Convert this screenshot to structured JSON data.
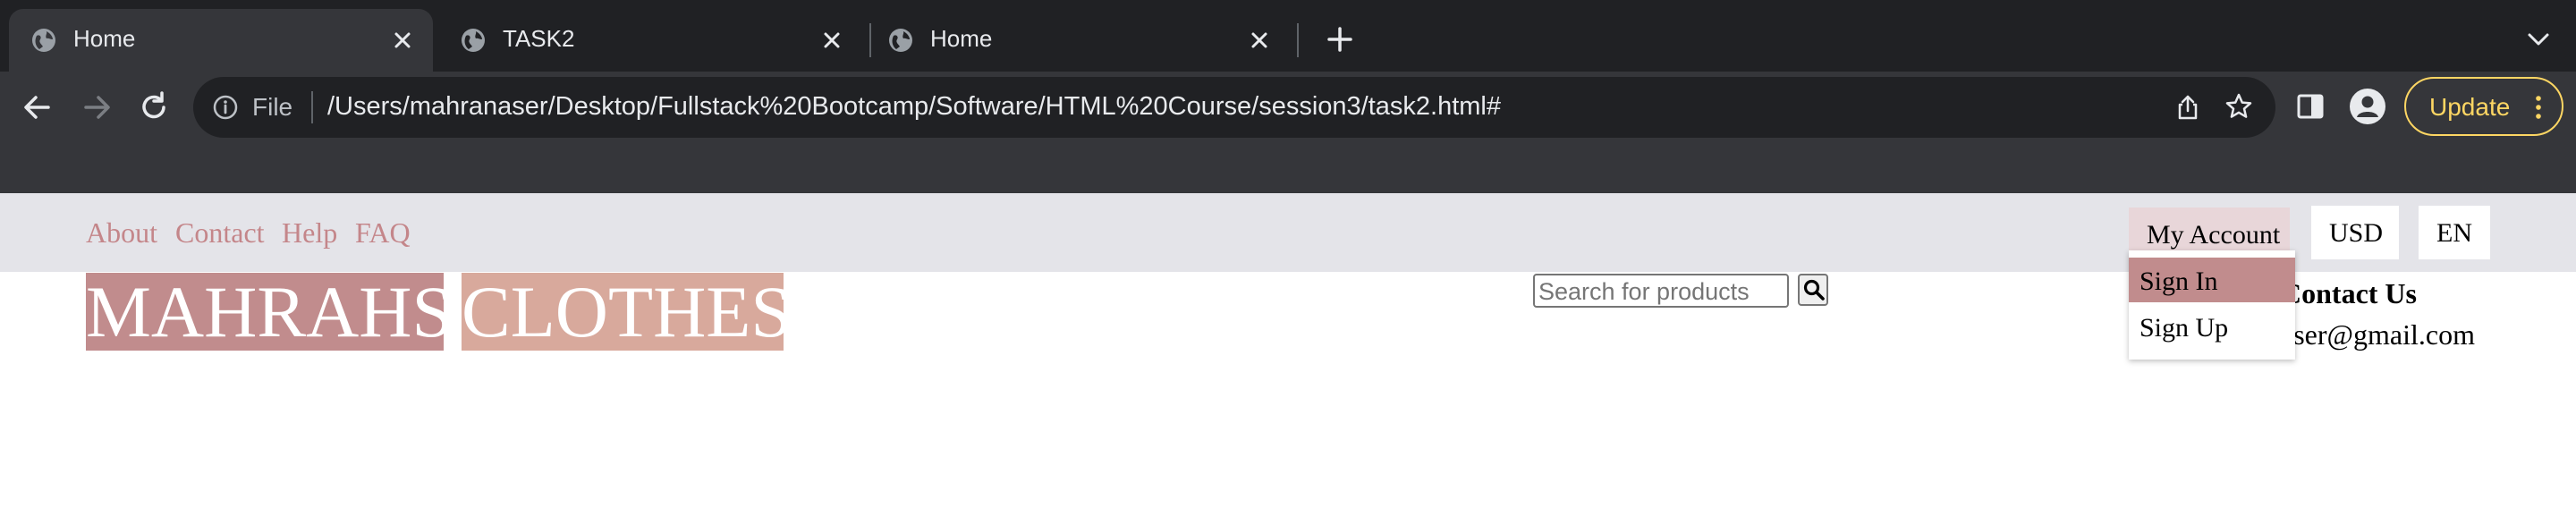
{
  "browser": {
    "tabs": [
      {
        "title": "Home",
        "active": true
      },
      {
        "title": "TASK2",
        "active": false
      },
      {
        "title": "Home",
        "active": false
      }
    ],
    "address_bar": {
      "scheme_label": "File",
      "url": "/Users/mahranaser/Desktop/Fullstack%20Bootcamp/Software/HTML%20Course/session3/task2.html#"
    },
    "update_label": "Update",
    "colors": {
      "frame": "#202124",
      "toolbar": "#35363a",
      "update": "#fdd663"
    }
  },
  "page": {
    "top_links": [
      "About",
      "Contact",
      "Help",
      "FAQ"
    ],
    "account": {
      "label": "My Account",
      "menu": [
        {
          "label": "Sign In",
          "highlighted": true
        },
        {
          "label": "Sign Up",
          "highlighted": false
        }
      ]
    },
    "currency": "USD",
    "language": "EN",
    "logo": {
      "first": "MAHRAHS",
      "second": "CLOTHES"
    },
    "search": {
      "placeholder": "Search for products",
      "button_icon": "search-icon"
    },
    "contact": {
      "heading": "Contact Us",
      "email": "aser@gmail.com"
    },
    "colors": {
      "topbar_bg": "#e4e4e9",
      "link": "#c4868a",
      "logo_first_bg": "#c18c8d",
      "logo_second_bg": "#d8a99c",
      "menu_highlight": "#c18c8d",
      "account_bg": "#e8d6d9"
    }
  }
}
